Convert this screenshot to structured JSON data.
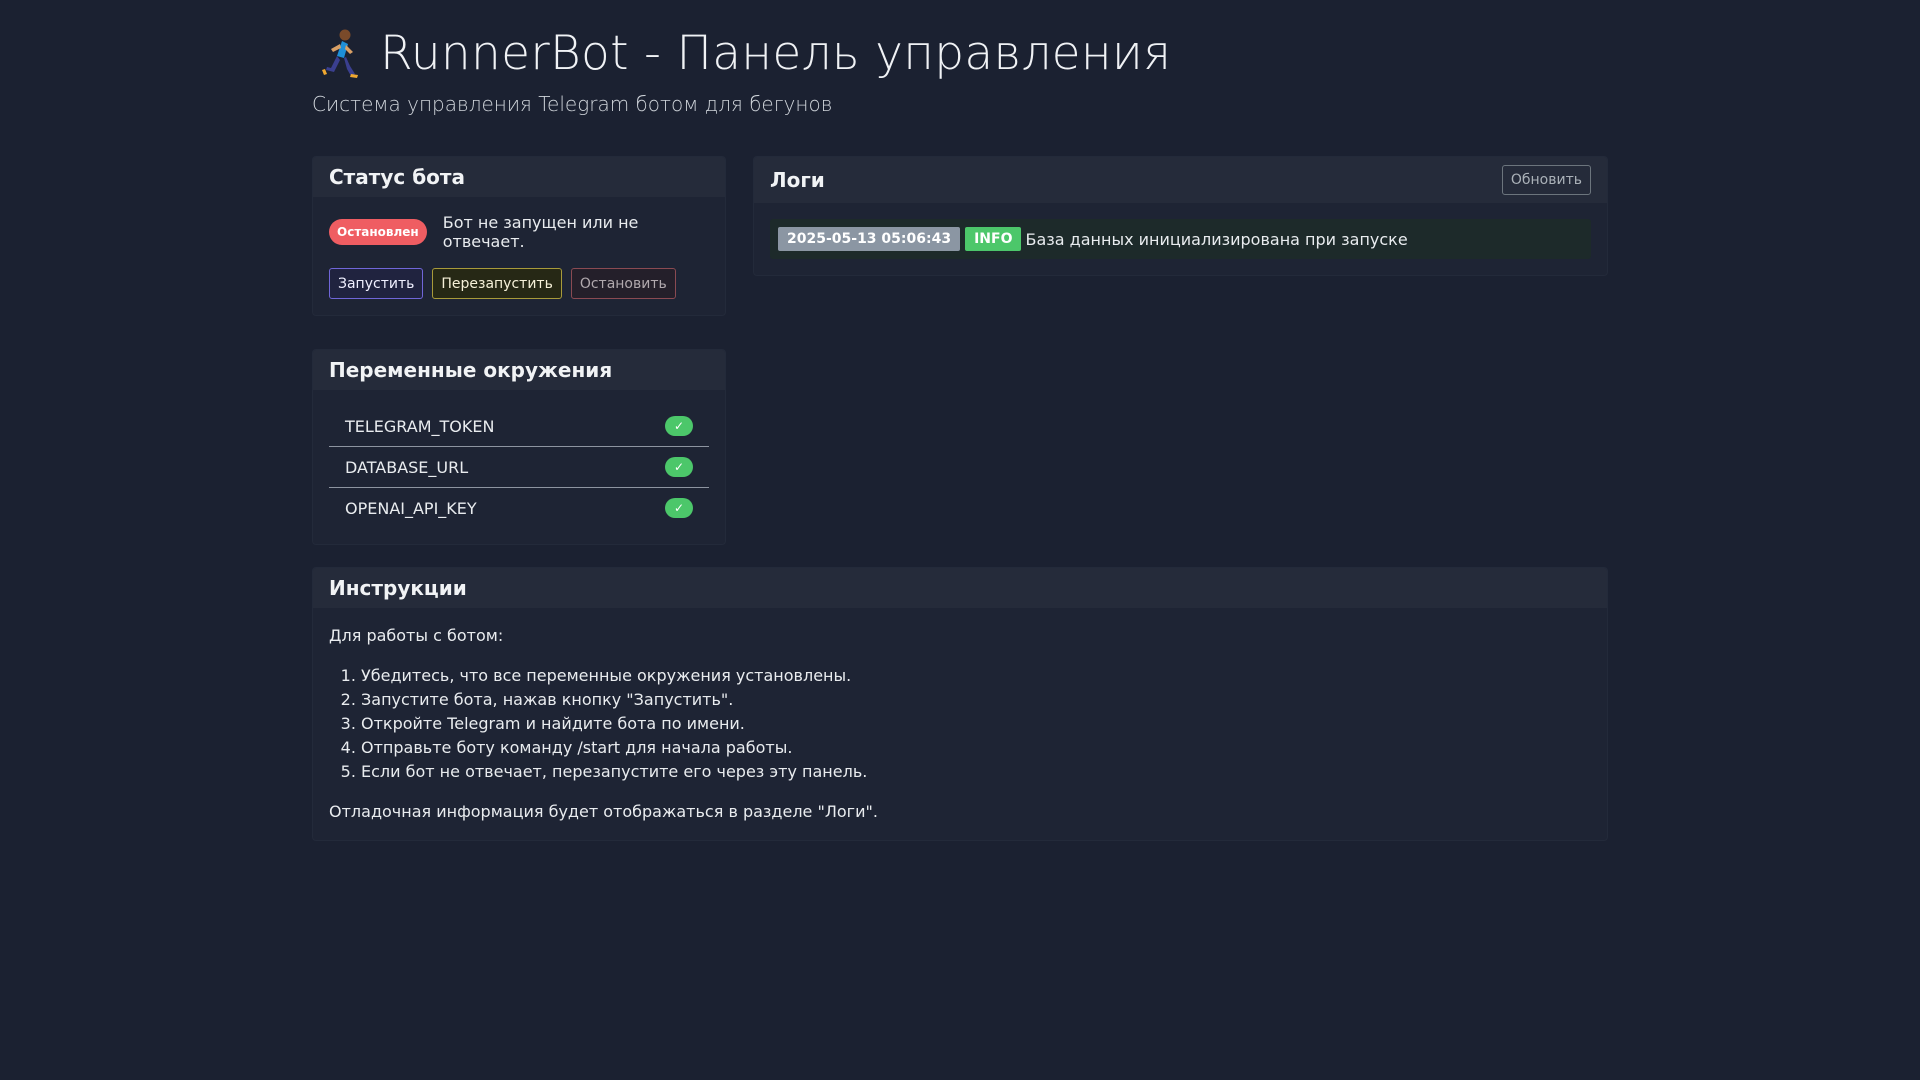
{
  "header": {
    "title": "RunnerBot - Панель управления",
    "subtitle": "Система управления Telegram ботом для бегунов"
  },
  "status_card": {
    "title": "Статус бота",
    "badge": "Остановлен",
    "message": "Бот не запущен или не отвечает.",
    "buttons": {
      "start": "Запустить",
      "restart": "Перезапустить",
      "stop": "Остановить"
    }
  },
  "env_card": {
    "title": "Переменные окружения",
    "items": [
      {
        "name": "TELEGRAM_TOKEN",
        "status": "✓"
      },
      {
        "name": "DATABASE_URL",
        "status": "✓"
      },
      {
        "name": "OPENAI_API_KEY",
        "status": "✓"
      }
    ]
  },
  "logs_card": {
    "title": "Логи",
    "refresh_label": "Обновить",
    "entries": [
      {
        "timestamp": "2025-05-13 05:06:43",
        "level": "INFO",
        "message": "База данных инициализирована при запуске"
      }
    ]
  },
  "instructions_card": {
    "title": "Инструкции",
    "intro": "Для работы с ботом:",
    "steps": [
      "Убедитесь, что все переменные окружения установлены.",
      "Запустите бота, нажав кнопку \"Запустить\".",
      "Откройте Telegram и найдите бота по имени.",
      "Отправьте боту команду /start для начала работы.",
      "Если бот не отвечает, перезапустите его через эту панель."
    ],
    "footer": "Отладочная информация будет отображаться в разделе \"Логи\"."
  },
  "colors": {
    "background": "#1b2131",
    "card_header": "#252b3a",
    "danger": "#ef5d62",
    "success": "#4cc76a",
    "primary": "#7066d8",
    "warning": "#a89a3a"
  }
}
